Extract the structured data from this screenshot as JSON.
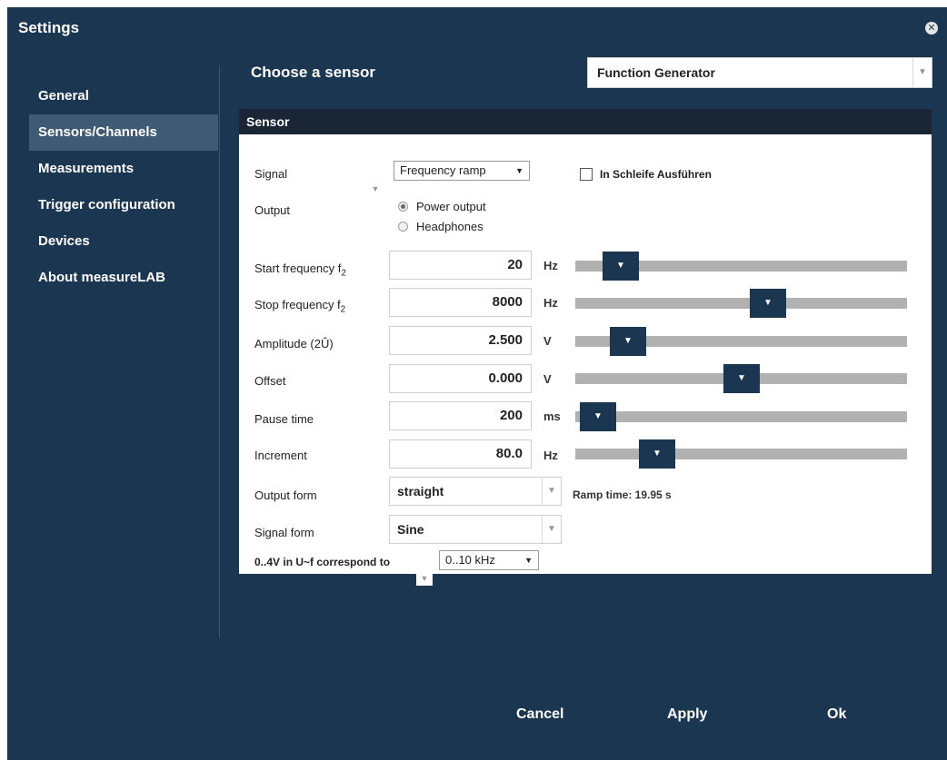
{
  "window": {
    "title": "Settings",
    "close_icon": "close-icon"
  },
  "sidebar": {
    "items": [
      {
        "label": "General",
        "active": false
      },
      {
        "label": "Sensors/Channels",
        "active": true
      },
      {
        "label": "Measurements",
        "active": false
      },
      {
        "label": "Trigger configuration",
        "active": false
      },
      {
        "label": "Devices",
        "active": false
      },
      {
        "label": "About measureLAB",
        "active": false
      }
    ]
  },
  "header": {
    "title": "Choose a sensor",
    "sensor_selected": "Function Generator"
  },
  "panel": {
    "title": "Sensor",
    "signal_label": "Signal",
    "signal_value": "Frequency ramp",
    "loop_label": "In Schleife Ausführen",
    "loop_checked": false,
    "output_label": "Output",
    "output_options": [
      "Power output",
      "Headphones"
    ],
    "output_selected": "Power output",
    "params": [
      {
        "label": "Start frequency f",
        "sub": "2",
        "value": "20",
        "unit": "Hz",
        "level_pct": 7
      },
      {
        "label": "Stop frequency f",
        "sub": "2",
        "value": "8000",
        "unit": "Hz",
        "level_pct": 57
      },
      {
        "label": "Amplitude (2Û)",
        "sub": "",
        "value": "2.500",
        "unit": "V",
        "level_pct": 9
      },
      {
        "label": "Offset",
        "sub": "",
        "value": "0.000",
        "unit": "V",
        "level_pct": 50
      },
      {
        "label": "Pause time",
        "sub": "",
        "value": "200",
        "unit": "ms",
        "level_pct": 2
      },
      {
        "label": "Increment",
        "sub": "",
        "value": "80.0",
        "unit": "Hz",
        "level_pct": 22
      }
    ],
    "output_form_label": "Output form",
    "output_form_value": "straight",
    "ramp_time": "Ramp time: 19.95 s",
    "signal_form_label": "Signal form",
    "signal_form_value": "Sine",
    "range_label": "0..4V in U~f correspond to",
    "range_value": "0..10 kHz"
  },
  "footer": {
    "cancel": "Cancel",
    "apply": "Apply",
    "ok": "Ok"
  },
  "colors": {
    "background": "#1b3651",
    "active_item": "#3f5a75",
    "panel_header": "#1a2535",
    "slider_thumb": "#1b3651"
  }
}
